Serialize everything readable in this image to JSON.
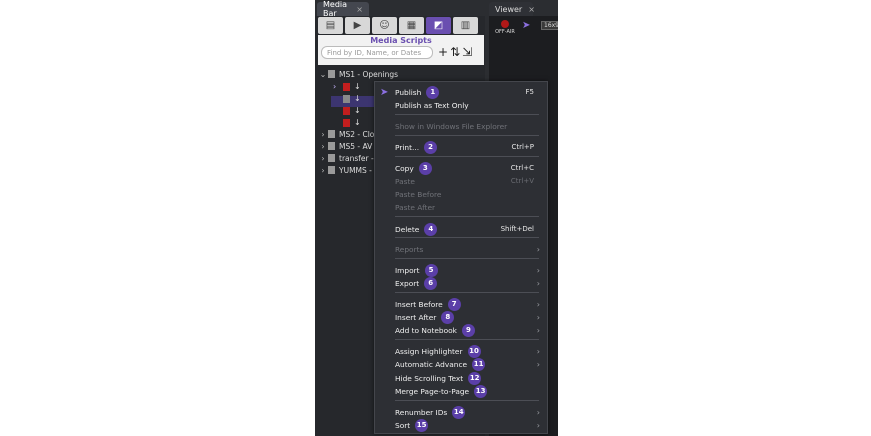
{
  "tabs": {
    "media_bar": "Media Bar",
    "viewer": "Viewer",
    "close_glyph": "×"
  },
  "media_scripts": {
    "title": "Media Scripts",
    "search_placeholder": "Find by ID, Name, or Dates"
  },
  "viewer": {
    "off_air": "OFF-AIR",
    "ratio": "16x9"
  },
  "tree": [
    {
      "label": "MS1 - Openings",
      "expanded": true
    },
    {
      "label": "MS2 - Clo"
    },
    {
      "label": "MS5 - AV"
    },
    {
      "label": "transfer -"
    },
    {
      "label": "YUMMS -"
    }
  ],
  "menu": {
    "items": [
      {
        "label": "Publish",
        "shortcut": "F5",
        "badge": "1",
        "disabled": false
      },
      {
        "label": "Publish as Text Only",
        "shortcut": "",
        "badge": "",
        "disabled": false
      },
      {
        "label": "Show in Windows File Explorer",
        "shortcut": "",
        "badge": "",
        "disabled": true
      },
      {
        "label": "Print...",
        "shortcut": "Ctrl+P",
        "badge": "2",
        "disabled": false
      },
      {
        "label": "Copy",
        "shortcut": "Ctrl+C",
        "badge": "3",
        "disabled": false
      },
      {
        "label": "Paste",
        "shortcut": "Ctrl+V",
        "badge": "",
        "disabled": true
      },
      {
        "label": "Paste Before",
        "shortcut": "",
        "badge": "",
        "disabled": true
      },
      {
        "label": "Paste After",
        "shortcut": "",
        "badge": "",
        "disabled": true
      },
      {
        "label": "Delete",
        "shortcut": "Shift+Del",
        "badge": "4",
        "disabled": false
      },
      {
        "label": "Reports",
        "shortcut": "",
        "badge": "",
        "disabled": true,
        "submenu": true
      },
      {
        "label": "Import",
        "shortcut": "",
        "badge": "5",
        "disabled": false,
        "submenu": true
      },
      {
        "label": "Export",
        "shortcut": "",
        "badge": "6",
        "disabled": false,
        "submenu": true
      },
      {
        "label": "Insert Before",
        "shortcut": "",
        "badge": "7",
        "disabled": false,
        "submenu": true
      },
      {
        "label": "Insert After",
        "shortcut": "",
        "badge": "8",
        "disabled": false,
        "submenu": true
      },
      {
        "label": "Add to Notebook",
        "shortcut": "",
        "badge": "9",
        "disabled": false,
        "submenu": true
      },
      {
        "label": "Assign Highlighter",
        "shortcut": "",
        "badge": "10",
        "disabled": false,
        "submenu": true
      },
      {
        "label": "Automatic Advance",
        "shortcut": "",
        "badge": "11",
        "disabled": false,
        "submenu": true
      },
      {
        "label": "Hide Scrolling Text",
        "shortcut": "",
        "badge": "12",
        "disabled": false
      },
      {
        "label": "Merge Page-to-Page",
        "shortcut": "",
        "badge": "13",
        "disabled": false
      },
      {
        "label": "Renumber IDs",
        "shortcut": "",
        "badge": "14",
        "disabled": false,
        "submenu": true
      },
      {
        "label": "Sort",
        "shortcut": "",
        "badge": "15",
        "disabled": false,
        "submenu": true
      }
    ],
    "submenu_arrow": "›"
  },
  "colors": {
    "accent": "#6a4fb0",
    "badge": "#5b3fa8",
    "menu_bg": "#2d2f34"
  }
}
